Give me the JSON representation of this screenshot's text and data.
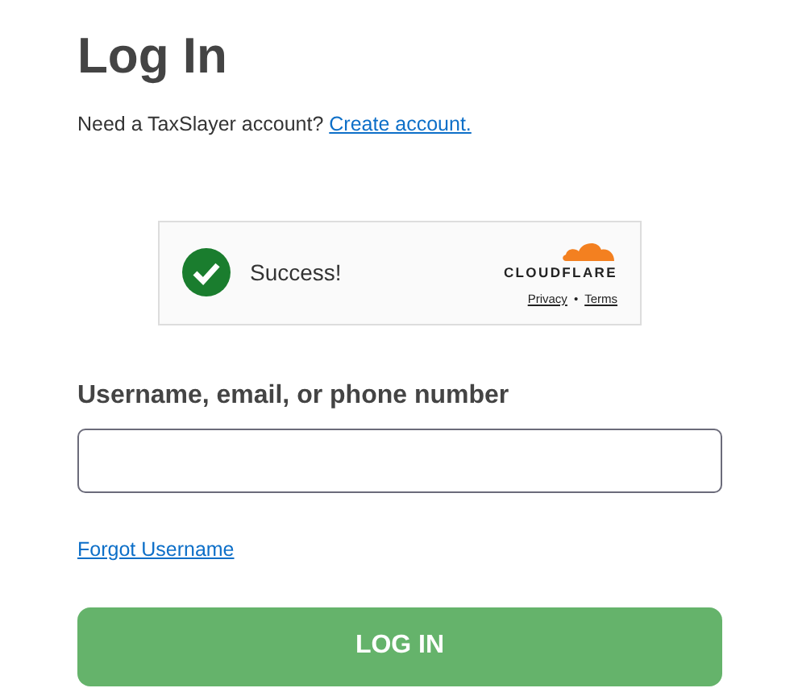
{
  "title": "Log In",
  "signup": {
    "prompt": "Need a TaxSlayer account?",
    "link": "Create account."
  },
  "captcha": {
    "verified": true,
    "status": "Success!",
    "brand": "CLOUDFLARE",
    "links": [
      "Privacy",
      "Terms"
    ],
    "separator": "•"
  },
  "field": {
    "label": "Username, email, or phone number"
  },
  "forgot": "Forgot Username",
  "submit": "LOG IN"
}
